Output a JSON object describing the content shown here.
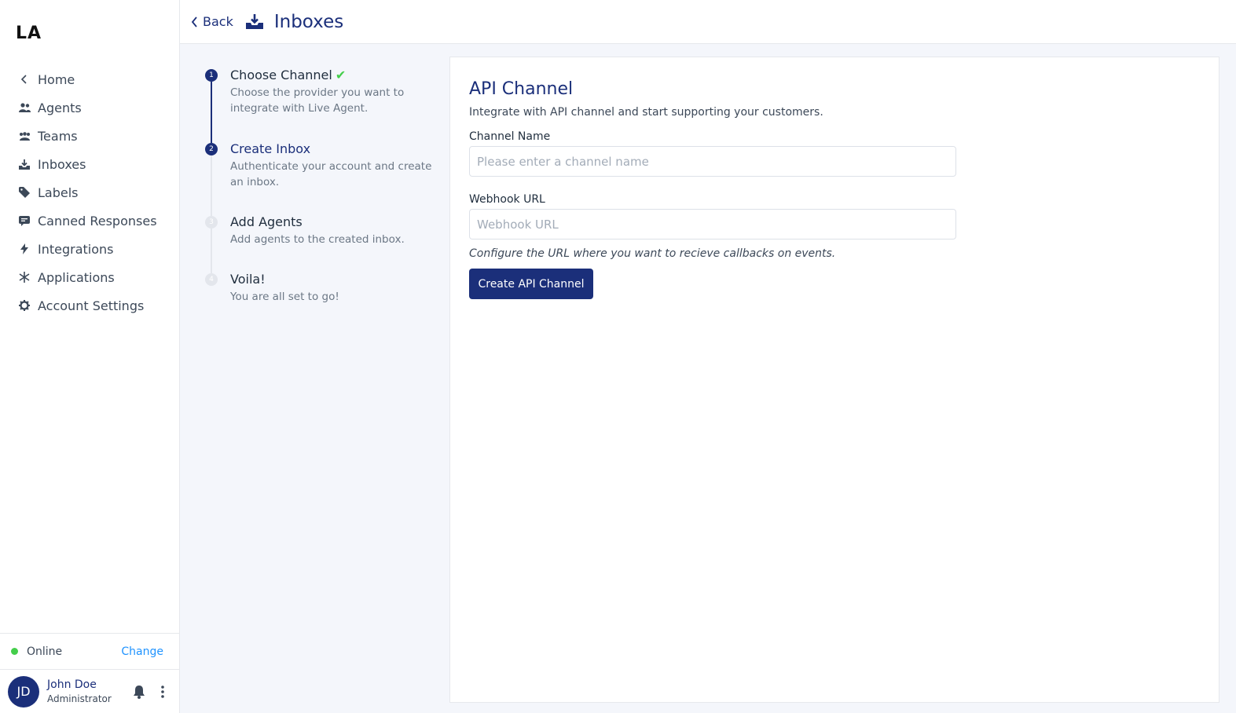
{
  "sidebar": {
    "logo": "LA",
    "items": [
      {
        "label": "Home",
        "icon": "chevron-left-icon"
      },
      {
        "label": "Agents",
        "icon": "people-icon"
      },
      {
        "label": "Teams",
        "icon": "team-icon"
      },
      {
        "label": "Inboxes",
        "icon": "inbox-download-icon"
      },
      {
        "label": "Labels",
        "icon": "tag-icon"
      },
      {
        "label": "Canned Responses",
        "icon": "chat-icon"
      },
      {
        "label": "Integrations",
        "icon": "lightning-icon"
      },
      {
        "label": "Applications",
        "icon": "asterisk-icon"
      },
      {
        "label": "Account Settings",
        "icon": "gear-icon"
      }
    ],
    "status": {
      "label": "Online",
      "change": "Change",
      "color": "#44ce4b"
    },
    "user": {
      "initials": "JD",
      "name": "John Doe",
      "role": "Administrator"
    }
  },
  "header": {
    "back": "Back",
    "title": "Inboxes"
  },
  "steps": [
    {
      "num": "1",
      "title": "Choose Channel",
      "desc": "Choose the provider you want to integrate with Live Agent.",
      "state": "done"
    },
    {
      "num": "2",
      "title": "Create Inbox",
      "desc": "Authenticate your account and create an inbox.",
      "state": "active"
    },
    {
      "num": "3",
      "title": "Add Agents",
      "desc": "Add agents to the created inbox.",
      "state": "todo"
    },
    {
      "num": "4",
      "title": "Voila!",
      "desc": "You are all set to go!",
      "state": "todo"
    }
  ],
  "form": {
    "title": "API Channel",
    "description": "Integrate with API channel and start supporting your customers.",
    "channel_name_label": "Channel Name",
    "channel_name_placeholder": "Please enter a channel name",
    "channel_name_value": "",
    "webhook_label": "Webhook URL",
    "webhook_placeholder": "Webhook URL",
    "webhook_value": "",
    "webhook_help": "Configure the URL where you want to recieve callbacks on events.",
    "submit": "Create API Channel"
  },
  "colors": {
    "brand": "#1b2f7a",
    "accent": "#1f93ff",
    "success": "#44ce4b"
  }
}
